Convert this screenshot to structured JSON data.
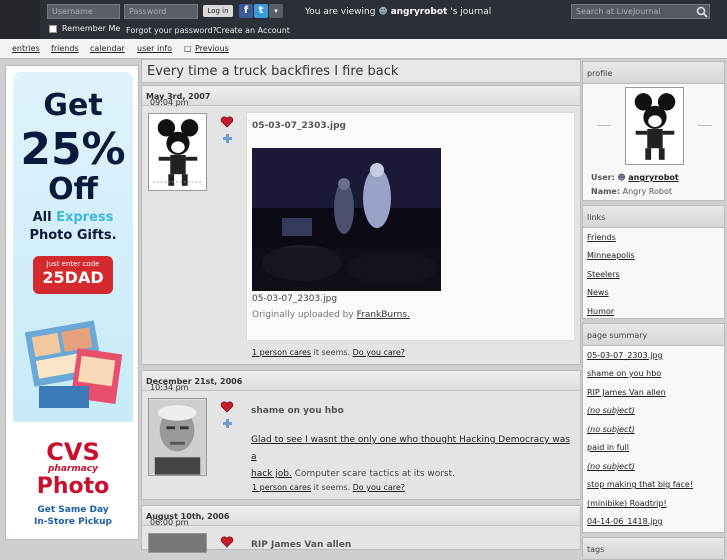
{
  "topbar": {
    "username_placeholder": "Username",
    "password_placeholder": "Password",
    "login_label": "Log in",
    "remember_label": "Remember Me",
    "forgot_label": "Forgot your password?",
    "create_label": "Create an Account",
    "viewing_prefix": "You are viewing",
    "viewing_user": "angryrobot",
    "viewing_suffix": "'s journal",
    "search_placeholder": "Search at LiveJournal"
  },
  "nav": {
    "entries": "entries",
    "friends": "friends",
    "calendar": "calendar",
    "userinfo": "user info",
    "previous": "Previous"
  },
  "ad": {
    "get": "Get",
    "percent": "25%",
    "off": "Off",
    "all": "All",
    "express": "Express",
    "photo_gifts": "Photo Gifts.",
    "code_lead": "Just enter code",
    "code": "25DAD",
    "cvs": "CVS",
    "pharmacy": "pharmacy",
    "photo": "Photo",
    "same_day": "Get Same Day",
    "pickup": "In-Store Pickup"
  },
  "journal_title": "Every time a truck backfires I fire back",
  "entries": [
    {
      "time": "09:04 pm",
      "date": "May 3rd, 2007",
      "subject": "05-03-07_2303.jpg",
      "caption": "05-03-07_2303.jpg",
      "uploaded_prefix": "Originally uploaded by",
      "uploaded_by": "FrankBurns.",
      "cares_link": "1 person cares",
      "cares_mid": "it seems.",
      "care_q": "Do you care?"
    },
    {
      "time": "10:34 pm",
      "date": "December 21st, 2006",
      "subject": "shame on you hbo",
      "body_line1": "Glad to see I wasnt the only one who thought Hacking Democracy was a",
      "body_link2": "hack job.",
      "body_rest2": "Computer scare tactics at its worst.",
      "cares_link": "1 person cares",
      "cares_mid": "it seems.",
      "care_q": "Do you care?"
    },
    {
      "time": "06:00 pm",
      "date": "August 10th, 2006",
      "subject": "RIP James Van allen"
    }
  ],
  "sidebar": {
    "profile_head": "profile",
    "user_label": "User:",
    "user_value": "angryrobot",
    "name_label": "Name:",
    "name_value": "Angry Robot",
    "links_head": "links",
    "links": [
      "Friends",
      "Minneapolis",
      "Steelers",
      "News",
      "Humor"
    ],
    "summary_head": "page summary",
    "summary": [
      {
        "t": "05-03-07_2303.jpg",
        "i": false
      },
      {
        "t": "shame on you hbo",
        "i": false
      },
      {
        "t": "RIP James Van allen",
        "i": false
      },
      {
        "t": "(no subject)",
        "i": true
      },
      {
        "t": "(no subject)",
        "i": true
      },
      {
        "t": "paid in full",
        "i": false
      },
      {
        "t": "(no subject)",
        "i": true
      },
      {
        "t": "stop making that big face!",
        "i": false
      },
      {
        "t": "(minibike) Roadtrip!",
        "i": false
      },
      {
        "t": "04-14-06_1418.jpg",
        "i": false
      }
    ],
    "tags_head": "tags"
  },
  "colors": {
    "topbar_bg": "#2b2f36",
    "facebook": "#3b5998",
    "twitter": "#3a9bd9",
    "cvs_red": "#c8102e"
  }
}
